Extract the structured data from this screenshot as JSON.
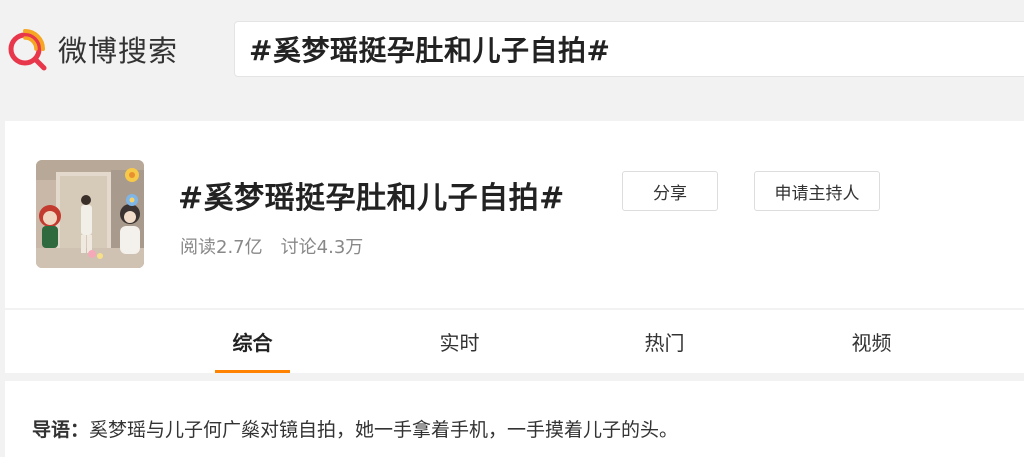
{
  "header": {
    "logo_text": "微博搜索",
    "search_value": "#奚梦瑶挺孕肚和儿子自拍#"
  },
  "topic": {
    "title": "#奚梦瑶挺孕肚和儿子自拍#",
    "reads": "阅读2.7亿",
    "discussions": "讨论4.3万",
    "share_label": "分享",
    "host_label": "申请主持人"
  },
  "tabs": [
    {
      "label": "综合",
      "active": true
    },
    {
      "label": "实时",
      "active": false
    },
    {
      "label": "热门",
      "active": false
    },
    {
      "label": "视频",
      "active": false
    }
  ],
  "guide": {
    "label": "导语：",
    "text": "奚梦瑶与儿子何广燊对镜自拍，她一手拿着手机，一手摸着儿子的头。"
  },
  "colors": {
    "brand_orange": "#ff8200",
    "logo_red": "#e8364b",
    "logo_orange": "#f5a623"
  }
}
